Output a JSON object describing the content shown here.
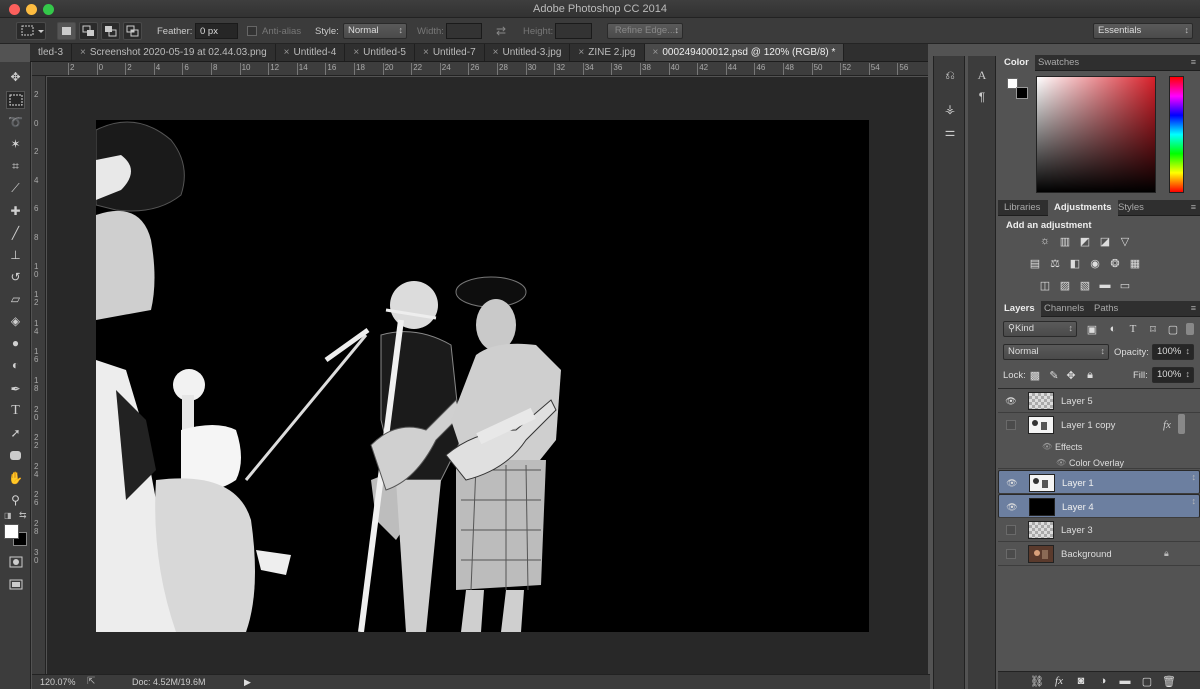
{
  "app": {
    "title": "Adobe Photoshop CC 2014"
  },
  "options": {
    "feather_label": "Feather:",
    "feather_value": "0 px",
    "antialias_label": "Anti-alias",
    "style_label": "Style:",
    "style_value": "Normal",
    "width_label": "Width:",
    "height_label": "Height:",
    "refine_edge": "Refine Edge...",
    "workspace": "Essentials"
  },
  "tabs": [
    {
      "label": "tled-3",
      "close": ""
    },
    {
      "label": "Screenshot 2020-05-19 at 02.44.03.png",
      "close": "×"
    },
    {
      "label": "Untitled-4",
      "close": "×"
    },
    {
      "label": "Untitled-5",
      "close": "×"
    },
    {
      "label": "Untitled-7",
      "close": "×"
    },
    {
      "label": "Untitled-3.jpg",
      "close": "×"
    },
    {
      "label": "ZINE 2.jpg",
      "close": "×"
    },
    {
      "label": "000249400012.psd @ 120% (RGB/8) *",
      "close": "×"
    }
  ],
  "ruler": {
    "h": [
      "2",
      "0",
      "2",
      "4",
      "6",
      "8",
      "10",
      "12",
      "14",
      "16",
      "18",
      "20",
      "22",
      "24",
      "26",
      "28",
      "30",
      "32",
      "34",
      "36",
      "38",
      "40",
      "42",
      "44",
      "46",
      "48",
      "50",
      "52",
      "54",
      "56"
    ],
    "v": [
      "2",
      "0",
      "2",
      "4",
      "6",
      "8",
      "1\n0",
      "1\n2",
      "1\n4",
      "1\n6",
      "1\n8",
      "2\n0",
      "2\n2",
      "2\n4",
      "2\n6",
      "2\n8",
      "3\n0"
    ]
  },
  "status": {
    "zoom": "120.07%",
    "doc": "Doc: 4.52M/19.6M"
  },
  "color_panel": {
    "tabs": [
      "Color",
      "Swatches"
    ],
    "hue_color": "#d8202a"
  },
  "adjustments_panel": {
    "tabs": [
      "Libraries",
      "Adjustments",
      "Styles"
    ],
    "heading": "Add an adjustment"
  },
  "layers_panel": {
    "tabs": [
      "Layers",
      "Channels",
      "Paths"
    ],
    "filter_kind": "Kind",
    "blend_mode": "Normal",
    "opacity_label": "Opacity:",
    "opacity_value": "100%",
    "lock_label": "Lock:",
    "fill_label": "Fill:",
    "fill_value": "100%",
    "fx_label": "fx",
    "effects_label": "Effects",
    "color_overlay_label": "Color Overlay",
    "layers": [
      {
        "name": "Layer 5",
        "visible": true,
        "selected": false
      },
      {
        "name": "Layer 1 copy",
        "visible": false,
        "selected": false
      },
      {
        "name": "Layer 1",
        "visible": true,
        "selected": true
      },
      {
        "name": "Layer 4",
        "visible": true,
        "selected": true
      },
      {
        "name": "Layer 3",
        "visible": false,
        "selected": false
      },
      {
        "name": "Background",
        "visible": false,
        "selected": false
      }
    ]
  }
}
